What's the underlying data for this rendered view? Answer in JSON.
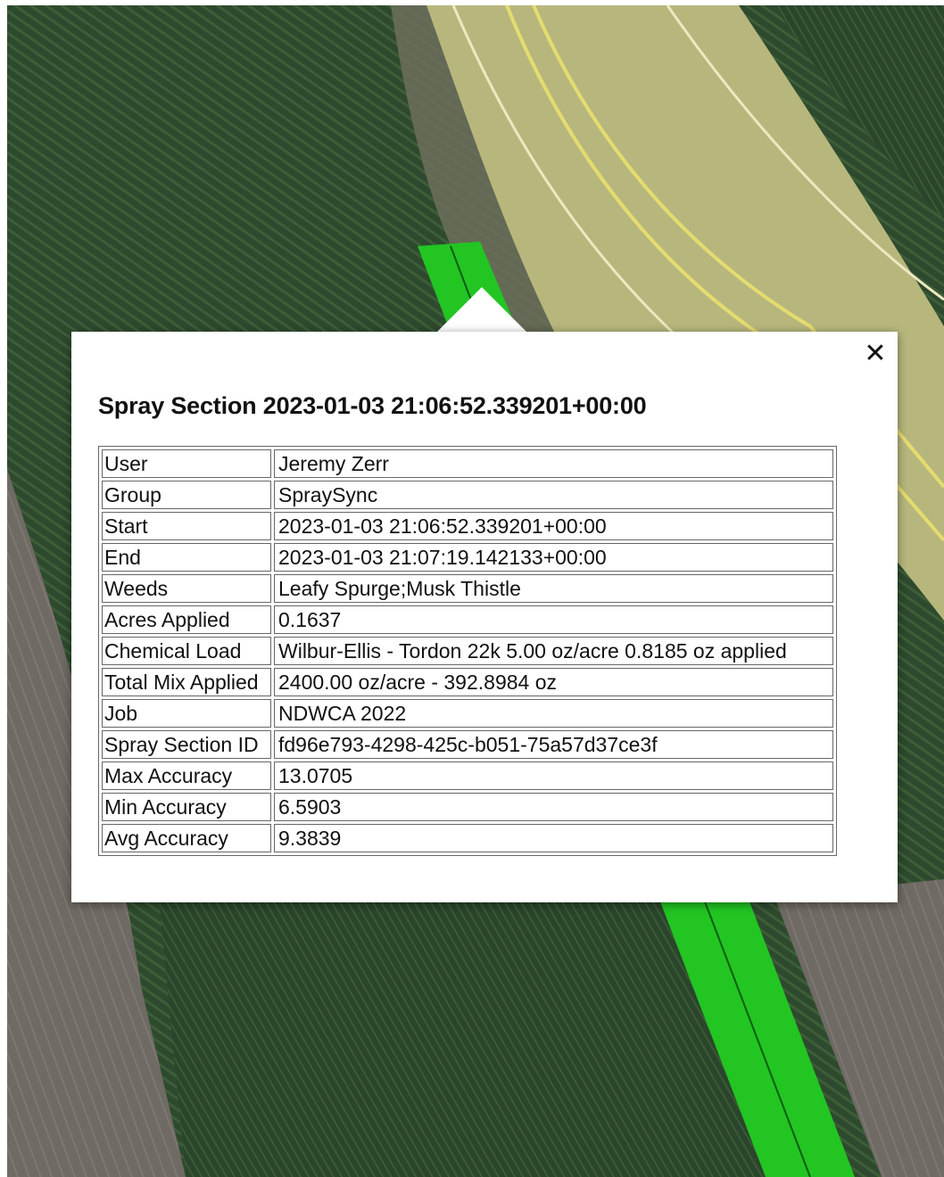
{
  "map": {
    "base_layer": "satellite imagery",
    "spray_color": "#22c522"
  },
  "popup": {
    "title": "Spray Section 2023-01-03 21:06:52.339201+00:00",
    "close_icon": "close-icon",
    "rows": [
      {
        "key": "User",
        "value": "Jeremy Zerr"
      },
      {
        "key": "Group",
        "value": "SpraySync"
      },
      {
        "key": "Start",
        "value": "2023-01-03 21:06:52.339201+00:00"
      },
      {
        "key": "End",
        "value": "2023-01-03 21:07:19.142133+00:00"
      },
      {
        "key": "Weeds",
        "value": "Leafy Spurge;Musk Thistle"
      },
      {
        "key": "Acres Applied",
        "value": "0.1637"
      },
      {
        "key": "Chemical Load",
        "value": "Wilbur-Ellis - Tordon 22k 5.00 oz/acre 0.8185 oz applied"
      },
      {
        "key": "Total Mix Applied",
        "value": "2400.00 oz/acre - 392.8984 oz"
      },
      {
        "key": "Job",
        "value": "NDWCA 2022"
      },
      {
        "key": "Spray Section ID",
        "value": "fd96e793-4298-425c-b051-75a57d37ce3f"
      },
      {
        "key": "Max Accuracy",
        "value": "13.0705"
      },
      {
        "key": "Min Accuracy",
        "value": "6.5903"
      },
      {
        "key": "Avg Accuracy",
        "value": "9.3839"
      }
    ]
  }
}
